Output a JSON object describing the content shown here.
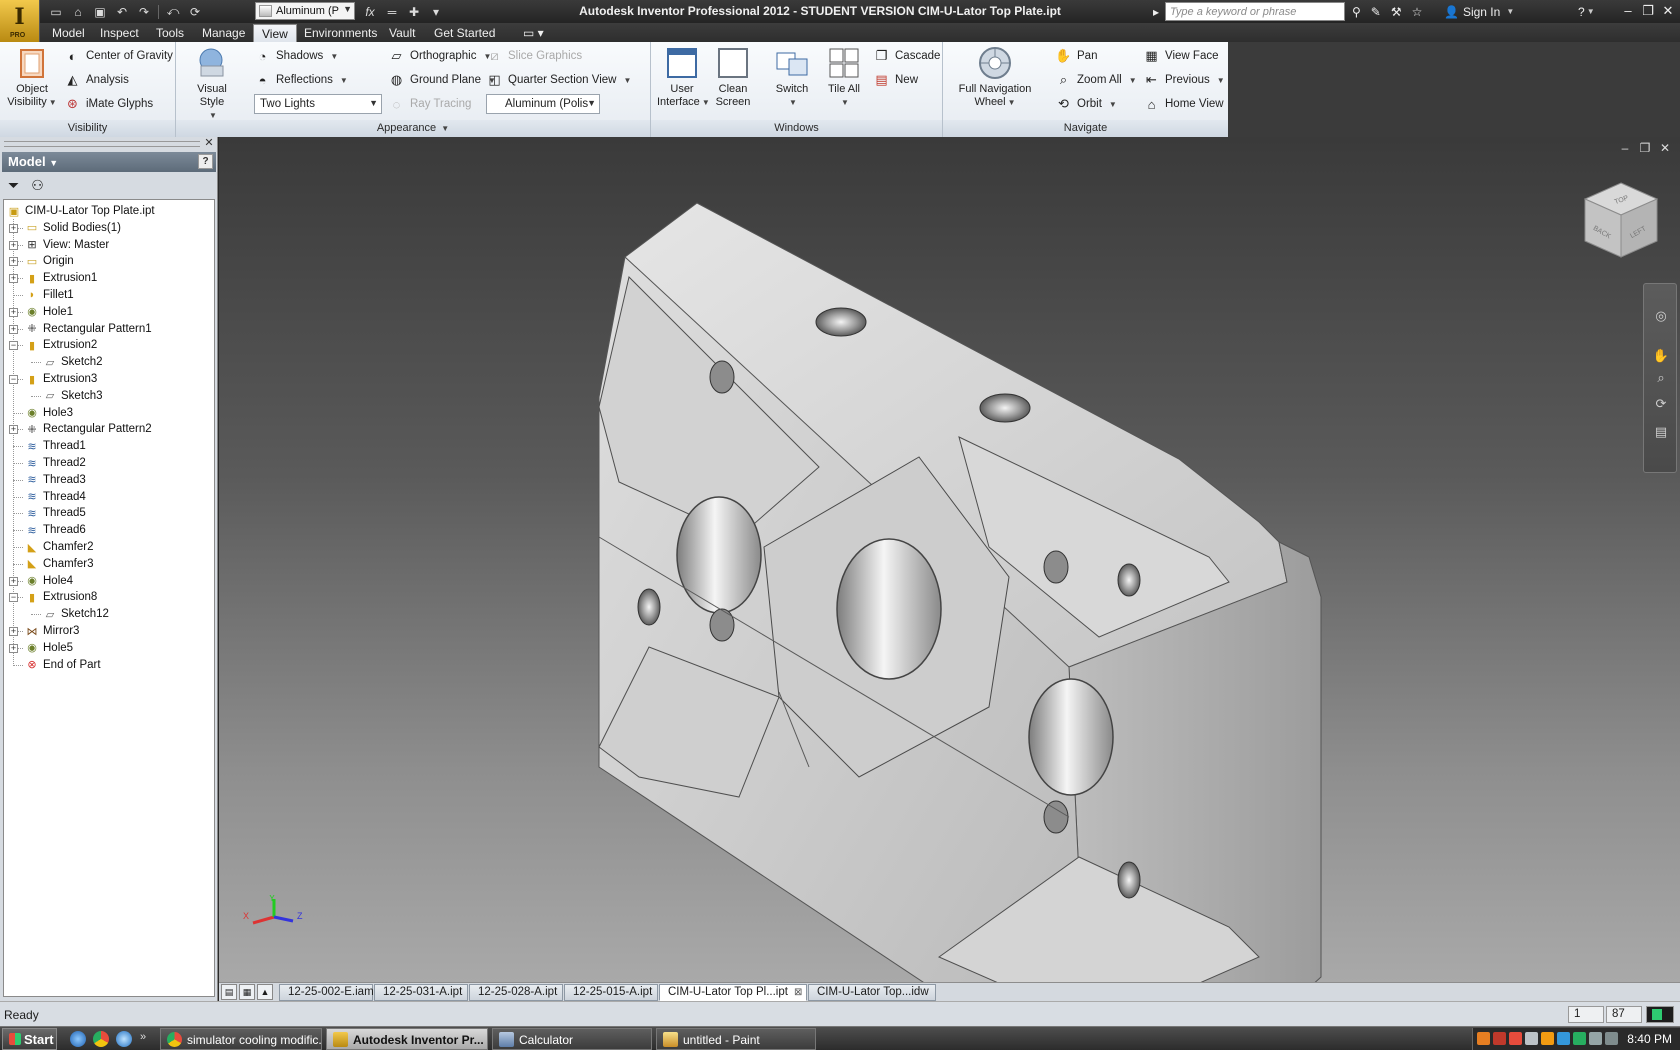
{
  "window": {
    "title": "Autodesk Inventor Professional 2012 - STUDENT VERSION    CIM-U-Lator Top Plate.ipt",
    "logo_label": "PRO",
    "material_combo": "Aluminum (P",
    "search_placeholder": "Type a keyword or phrase",
    "sign_in": "Sign In"
  },
  "ribbon_tabs": [
    "Model",
    "Inspect",
    "Tools",
    "Manage",
    "View",
    "Environments",
    "Vault",
    "Get Started"
  ],
  "active_tab": "View",
  "ribbon": {
    "visibility": {
      "title": "Visibility",
      "object_visibility": "Object Visibility",
      "center_of_gravity": "Center of Gravity",
      "analysis": "Analysis",
      "imate_glyphs": "iMate Glyphs"
    },
    "appearance": {
      "title": "Appearance",
      "visual_style": "Visual Style",
      "shadows": "Shadows",
      "reflections": "Reflections",
      "lighting": "Two Lights",
      "orthographic": "Orthographic",
      "ground_plane": "Ground Plane",
      "ray_tracing": "Ray Tracing",
      "slice_graphics": "Slice Graphics",
      "quarter_section": "Quarter Section View",
      "appearance_combo": "Aluminum (Polis"
    },
    "windows": {
      "title": "Windows",
      "user_interface": "User Interface",
      "clean_screen": "Clean Screen",
      "switch": "Switch",
      "tile_all": "Tile All",
      "cascade": "Cascade",
      "new": "New"
    },
    "navigate": {
      "title": "Navigate",
      "full_nav_wheel": "Full Navigation Wheel",
      "pan": "Pan",
      "zoom_all": "Zoom All",
      "orbit": "Orbit",
      "view_face": "View Face",
      "previous": "Previous",
      "home_view": "Home View"
    }
  },
  "browser": {
    "header": "Model",
    "tree": [
      {
        "label": "CIM-U-Lator Top Plate.ipt",
        "icon": "part-icon",
        "level": 0,
        "exp": ""
      },
      {
        "label": "Solid Bodies(1)",
        "icon": "folder-icon",
        "level": 1,
        "exp": "+"
      },
      {
        "label": "View: Master",
        "icon": "view-rep-icon",
        "level": 1,
        "exp": "+"
      },
      {
        "label": "Origin",
        "icon": "folder-icon",
        "level": 1,
        "exp": "+"
      },
      {
        "label": "Extrusion1",
        "icon": "extrusion-icon",
        "level": 1,
        "exp": "+"
      },
      {
        "label": "Fillet1",
        "icon": "fillet-icon",
        "level": 1,
        "exp": ""
      },
      {
        "label": "Hole1",
        "icon": "hole-icon",
        "level": 1,
        "exp": "+"
      },
      {
        "label": "Rectangular Pattern1",
        "icon": "pattern-icon",
        "level": 1,
        "exp": "+"
      },
      {
        "label": "Extrusion2",
        "icon": "extrusion-icon",
        "level": 1,
        "exp": "−"
      },
      {
        "label": "Sketch2",
        "icon": "sketch-icon",
        "level": 2,
        "exp": ""
      },
      {
        "label": "Extrusion3",
        "icon": "extrusion-icon",
        "level": 1,
        "exp": "−"
      },
      {
        "label": "Sketch3",
        "icon": "sketch-icon",
        "level": 2,
        "exp": ""
      },
      {
        "label": "Hole3",
        "icon": "hole-icon",
        "level": 1,
        "exp": ""
      },
      {
        "label": "Rectangular Pattern2",
        "icon": "pattern-icon",
        "level": 1,
        "exp": "+"
      },
      {
        "label": "Thread1",
        "icon": "thread-icon",
        "level": 1,
        "exp": ""
      },
      {
        "label": "Thread2",
        "icon": "thread-icon",
        "level": 1,
        "exp": ""
      },
      {
        "label": "Thread3",
        "icon": "thread-icon",
        "level": 1,
        "exp": ""
      },
      {
        "label": "Thread4",
        "icon": "thread-icon",
        "level": 1,
        "exp": ""
      },
      {
        "label": "Thread5",
        "icon": "thread-icon",
        "level": 1,
        "exp": ""
      },
      {
        "label": "Thread6",
        "icon": "thread-icon",
        "level": 1,
        "exp": ""
      },
      {
        "label": "Chamfer2",
        "icon": "chamfer-icon",
        "level": 1,
        "exp": ""
      },
      {
        "label": "Chamfer3",
        "icon": "chamfer-icon",
        "level": 1,
        "exp": ""
      },
      {
        "label": "Hole4",
        "icon": "hole-icon",
        "level": 1,
        "exp": "+"
      },
      {
        "label": "Extrusion8",
        "icon": "extrusion-icon",
        "level": 1,
        "exp": "−"
      },
      {
        "label": "Sketch12",
        "icon": "sketch-icon",
        "level": 2,
        "exp": ""
      },
      {
        "label": "Mirror3",
        "icon": "mirror-icon",
        "level": 1,
        "exp": "+"
      },
      {
        "label": "Hole5",
        "icon": "hole-icon",
        "level": 1,
        "exp": "+"
      },
      {
        "label": "End of Part",
        "icon": "end-of-part-icon",
        "level": 1,
        "exp": ""
      }
    ]
  },
  "viewcube": {
    "face_top": "TOP",
    "face_back": "BACK",
    "face_left": "LEFT"
  },
  "triad": {
    "x": "X",
    "y": "Y",
    "z": "Z"
  },
  "doc_tabs": [
    {
      "label": "12-25-002-E.iam",
      "active": false
    },
    {
      "label": "12-25-031-A.ipt",
      "active": false
    },
    {
      "label": "12-25-028-A.ipt",
      "active": false
    },
    {
      "label": "12-25-015-A.ipt",
      "active": false
    },
    {
      "label": "CIM-U-Lator Top Pl...ipt",
      "active": true
    },
    {
      "label": "CIM-U-Lator Top...idw",
      "active": false
    }
  ],
  "status": {
    "text": "Ready",
    "cell1": "1",
    "cell2": "87"
  },
  "taskbar": {
    "start": "Start",
    "buttons": [
      {
        "label": "simulator cooling modific...",
        "active": false
      },
      {
        "label": "Autodesk Inventor Pr...",
        "active": true
      },
      {
        "label": "Calculator",
        "active": false
      },
      {
        "label": "untitled - Paint",
        "active": false
      }
    ],
    "clock": "8:40 PM"
  },
  "colors": {
    "accent": "#f2c94c",
    "ribbon_bg": "#eef2f6",
    "dark_chrome": "#2e2e2e"
  }
}
